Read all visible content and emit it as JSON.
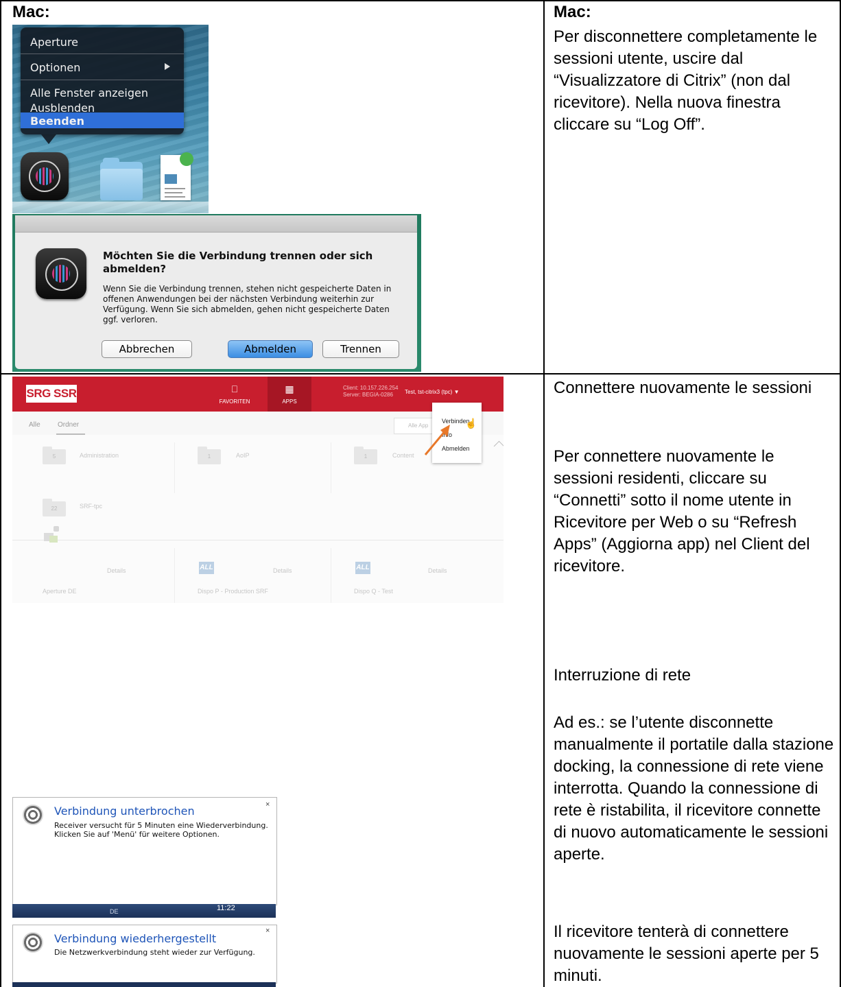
{
  "left_panel": {
    "mac_label": "Mac:",
    "dock_menu": {
      "items": [
        "Aperture",
        "Optionen",
        "Alle Fenster anzeigen",
        "Ausblenden",
        "Beenden"
      ],
      "selected": "Beenden"
    },
    "dialog": {
      "title": "Möchten Sie die Verbindung trennen oder sich abmelden?",
      "body": "Wenn Sie die Verbindung trennen, stehen nicht gespeicherte Daten in offenen Anwendungen bei der nächsten Verbindung weiterhin zur Verfügung. Wenn Sie sich abmelden, gehen nicht gespeicherte Daten ggf. verloren.",
      "buttons": {
        "cancel": "Abbrechen",
        "logoff": "Abmelden",
        "disconnect": "Trennen"
      }
    }
  },
  "right_panel": {
    "mac_label": "Mac:",
    "mac_text": "Per disconnettere completamente le sessioni utente, uscire dal “Visualizzatore di Citrix” (non dal ricevitore). Nella nuova finestra cliccare su “Log Off”.",
    "reconnect_title": "Connettere nuovamente le sessioni",
    "reconnect_text": "Per connettere nuovamente le sessioni residenti, cliccare su “Connetti” sotto il nome utente in Ricevitore per Web o su “Refresh Apps” (Aggiorna app) nel Client del ricevitore.",
    "network_title": "Interruzione di rete",
    "network_text_1": "Ad es.: se l’utente disconnette manualmente il portatile dalla stazione docking, la connessione di rete viene interrotta. Quando la connessione di rete è ristabilita, il ricevitore connette di nuovo automaticamente le sessioni aperte.",
    "network_text_2": "Il ricevitore tenterà di connettere nuovamente le sessioni aperte per 5 minuti."
  },
  "web": {
    "logo": "SRG SSR",
    "tabs": [
      {
        "label": "FAVORITEN",
        "icon": "bookmark-icon"
      },
      {
        "label": "APPS",
        "icon": "grid-icon"
      }
    ],
    "client_line": "Client: 10.157.226.254",
    "server_line": "Server: BEGIA-0286",
    "user": "Test, tst-citrix3 (tpc) ▼",
    "subtabs": [
      "Alle",
      "Ordner"
    ],
    "search_placeholder": "Alle App",
    "dropdown": [
      "Verbinden",
      "Info",
      "Abmelden"
    ],
    "folders": [
      {
        "count": "5",
        "name": "Administration"
      },
      {
        "count": "1",
        "name": "AoIP"
      },
      {
        "count": "1",
        "name": "Content"
      },
      {
        "count": "22",
        "name": "SRF-tpc"
      }
    ],
    "apps": [
      {
        "name": "Aperture DE",
        "details": "Details"
      },
      {
        "name": "Dispo P - Production SRF",
        "details": "Details"
      },
      {
        "name": "Dispo Q - Test",
        "details": "Details"
      }
    ],
    "all_icon_text": "ALL"
  },
  "toast1": {
    "title": "Verbindung unterbrochen",
    "body": "Receiver versucht für 5 Minuten eine Wiederverbindung. Klicken Sie auf 'Menü' für weitere Optionen.",
    "close": "×",
    "taskbar_time": "11:22",
    "taskbar_lang": "DE"
  },
  "toast2": {
    "title": "Verbindung wiederhergestellt",
    "body": "Die Netzwerkverbindung steht wieder zur Verfügung.",
    "close": "×"
  }
}
